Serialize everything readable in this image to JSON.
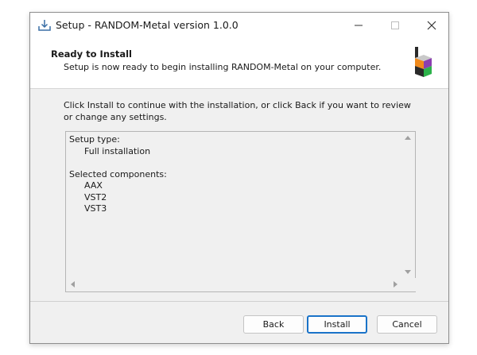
{
  "window": {
    "title": "Setup - RANDOM-Metal version 1.0.0",
    "icons": {
      "app": "installer-download-icon",
      "minimize": "minimize-icon",
      "maximize": "maximize-icon",
      "close": "close-icon"
    }
  },
  "header": {
    "title": "Ready to Install",
    "subtitle": "Setup is now ready to begin installing RANDOM-Metal on your computer.",
    "logo": "random-metal-logo"
  },
  "content": {
    "intro": "Click Install to continue with the installation, or click Back if you want to review or change any settings.",
    "summary": {
      "setup_type_label": "Setup type:",
      "setup_type_value": "Full installation",
      "components_label": "Selected components:",
      "components": [
        "AAX",
        "VST2",
        "VST3"
      ]
    }
  },
  "buttons": {
    "back": "Back",
    "install": "Install",
    "cancel": "Cancel"
  },
  "colors": {
    "accent": "#1a73c8",
    "logo_orange": "#f08a1c",
    "logo_purple": "#8a3fb0",
    "logo_green": "#2cb24a",
    "logo_dark": "#2a2a2a"
  }
}
